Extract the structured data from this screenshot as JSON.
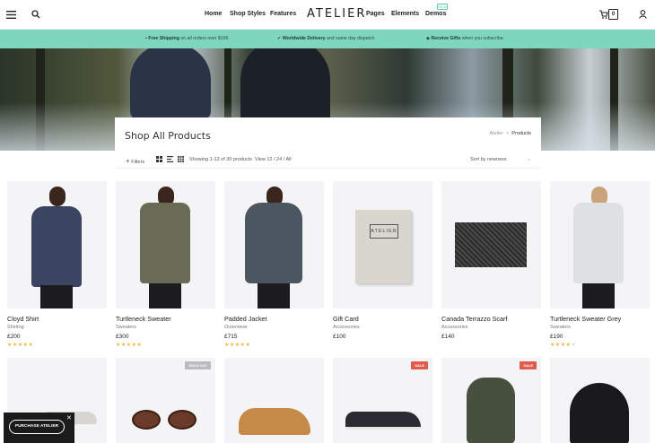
{
  "header": {
    "nav_left": [
      "Home",
      "Shop Styles",
      "Features"
    ],
    "logo": "ATELIER",
    "nav_right": [
      "Pages",
      "Elements",
      "Demos"
    ],
    "demos_badge": "NEW",
    "cart_count": "0"
  },
  "promo": {
    "items": [
      {
        "bold": "Free Shipping",
        "rest": " on all orders over $100."
      },
      {
        "bold": "Worldwide Delivery",
        "rest": " and same day dispatch."
      },
      {
        "bold": "Receive Gifts",
        "rest": " when you subscribe."
      }
    ]
  },
  "page": {
    "title": "Shop All Products",
    "breadcrumb": {
      "home": "Atelier",
      "sep": ">",
      "current": "Products"
    }
  },
  "toolbar": {
    "filters": "Filters",
    "showing": "Showing 1-12 of 30 products",
    "view_label": "View 12 / 24 / All",
    "sort": "Sort by newness"
  },
  "products": [
    {
      "name": "Cloyd Shirt",
      "category": "Shirting",
      "price": "£200",
      "rating": 5
    },
    {
      "name": "Turtleneck Sweater",
      "category": "Sweaters",
      "price": "£300",
      "rating": 5
    },
    {
      "name": "Padded Jacket",
      "category": "Outerwear",
      "price": "£715",
      "rating": 5
    },
    {
      "name": "Gift Card",
      "category": "Accessories",
      "price": "£100",
      "rating": 0
    },
    {
      "name": "Canada Terrazzo Scarf",
      "category": "Accessories",
      "price": "£140",
      "rating": 0
    },
    {
      "name": "Turtleneck Sweater Grey",
      "category": "Sweaters",
      "price": "£190",
      "rating": 4
    }
  ],
  "row2_badges": {
    "soldout": "SOLD OUT",
    "sale": "SALE"
  },
  "gift_card": {
    "brand": "ATELIER"
  },
  "purchase": {
    "label": "PURCHASE ATELIER",
    "close": "✕"
  },
  "colors": {
    "accent": "#7fd6bf",
    "star": "#f1b540",
    "sale": "#e15b4c"
  }
}
